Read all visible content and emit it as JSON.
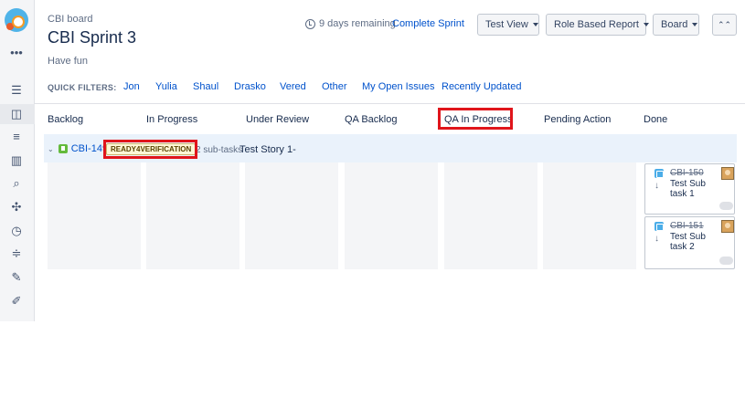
{
  "header": {
    "breadcrumb": "CBI board",
    "title": "CBI Sprint 3",
    "goal": "Have fun",
    "remaining": "9 days remaining",
    "complete_sprint": "Complete Sprint"
  },
  "toolbar": {
    "test_view": "Test View",
    "role_report": "Role Based Report",
    "board": "Board",
    "collapse": "⌃⌃"
  },
  "quick_filters": {
    "label": "QUICK FILTERS:",
    "items": [
      "Jon",
      "Yulia",
      "Shaul",
      "Drasko",
      "Vered",
      "Other",
      "My Open Issues",
      "Recently Updated"
    ]
  },
  "columns": [
    "Backlog",
    "In Progress",
    "Under Review",
    "QA Backlog",
    "QA In Progress",
    "Pending Action",
    "Done"
  ],
  "swimlane": {
    "key": "CBI-149",
    "status": "READY4VERIFICATION",
    "subtasks": "2 sub-tasks",
    "summary": "Test Story 1-"
  },
  "cards": [
    {
      "key": "CBI-150",
      "summary": "Test Sub task 1",
      "priority_icon": "arrow-down-icon"
    },
    {
      "key": "CBI-151",
      "summary": "Test Sub task 2",
      "priority_icon": "arrow-down-icon"
    }
  ],
  "highlight_color": "#e0151b"
}
